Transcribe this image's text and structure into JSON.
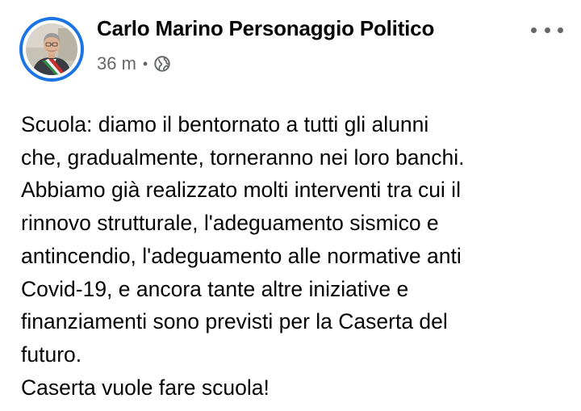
{
  "post": {
    "author": "Carlo Marino Personaggio Politico",
    "timestamp": "36 m",
    "separator": "•",
    "audience_icon": "globe-icon",
    "more_icon": "more-options-icon",
    "accent_color": "#1b74e4",
    "text_lines": [
      "Scuola: diamo il bentornato a tutti gli alunni",
      "che, gradualmente, torneranno nei loro banchi.",
      "Abbiamo già realizzato molti interventi tra cui il",
      "rinnovo strutturale, l'adeguamento sismico e",
      "antincendio, l'adeguamento alle normative anti",
      "Covid-19, e ancora tante altre iniziative e",
      "finanziamenti sono previsti per la Caserta del",
      "futuro.",
      "Caserta vuole fare scuola!"
    ]
  }
}
